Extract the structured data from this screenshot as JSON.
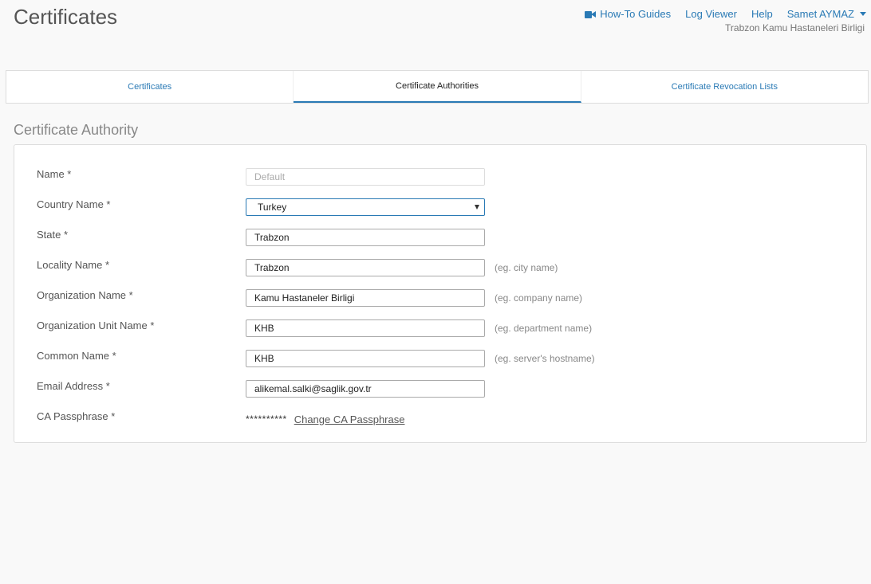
{
  "page": {
    "title": "Certificates"
  },
  "topnav": {
    "howto_label": "How-To Guides",
    "logviewer_label": "Log Viewer",
    "help_label": "Help",
    "user_label": "Samet AYMAZ",
    "org_label": "Trabzon Kamu Hastaneleri Birligi",
    "accent": "#2a7ab5"
  },
  "tabs": [
    {
      "label": "Certificates",
      "active": false
    },
    {
      "label": "Certificate Authorities",
      "active": true
    },
    {
      "label": "Certificate Revocation Lists",
      "active": false
    }
  ],
  "section": {
    "title": "Certificate Authority"
  },
  "form": {
    "name": {
      "label": "Name *",
      "placeholder": "Default"
    },
    "country": {
      "label": "Country Name *",
      "value": "Turkey"
    },
    "state": {
      "label": "State *",
      "value": "Trabzon"
    },
    "locality": {
      "label": "Locality Name *",
      "value": "Trabzon",
      "hint": "(eg. city name)"
    },
    "organization": {
      "label": "Organization Name *",
      "value": "Kamu Hastaneler Birligi",
      "hint": "(eg. company name)"
    },
    "org_unit": {
      "label": "Organization Unit Name *",
      "value": "KHB",
      "hint": "(eg. department name)"
    },
    "common_name": {
      "label": "Common Name *",
      "value": "KHB",
      "hint": "(eg. server's hostname)"
    },
    "email": {
      "label": "Email Address *",
      "value": "alikemal.salki@saglik.gov.tr"
    },
    "passphrase": {
      "label": "CA Passphrase *",
      "masked": "**********",
      "change_label": "Change CA Passphrase"
    }
  }
}
